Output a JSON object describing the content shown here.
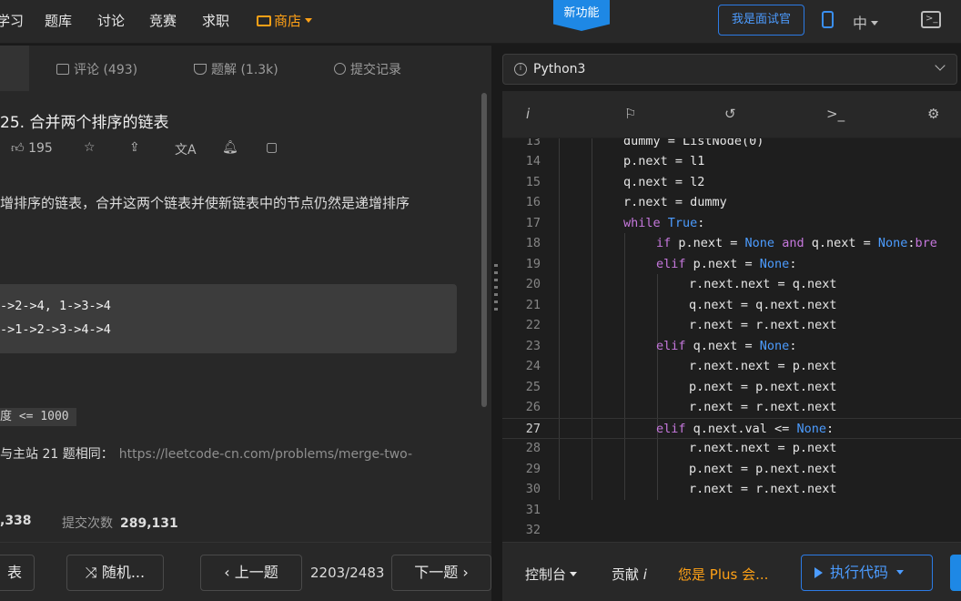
{
  "topnav": {
    "items": [
      "学习",
      "题库",
      "讨论",
      "竞赛",
      "求职"
    ],
    "shop": "商店",
    "new_feature": "新功能",
    "interviewer": "我是面试官",
    "lang": "中"
  },
  "left_tabs": {
    "comments": "评论 (493)",
    "solutions": "题解 (1.3k)",
    "submissions": "提交记录"
  },
  "problem": {
    "title": "25. 合并两个排序的链表",
    "likes": "195",
    "description": "增排序的链表，合并这两个链表并使新链表中的节点仍然是递增排序",
    "example_input": "->2->4, 1->3->4",
    "example_output": "->1->2->3->4->4",
    "constraint": "度 <= 1000",
    "note": "与主站 21 题相同：",
    "note_link": "https://leetcode-cn.com/problems/merge-two-",
    "accepted_count": ",338",
    "submissions_label": "提交次数",
    "submissions_count": "289,131"
  },
  "bottom_left": {
    "list_btn": "表",
    "random_btn": "随机...",
    "prev_btn": "上一题",
    "counter": "2203/2483",
    "next_btn": "下一题"
  },
  "editor": {
    "language": "Python3",
    "line_numbers": [
      "13",
      "14",
      "15",
      "16",
      "17",
      "18",
      "19",
      "20",
      "21",
      "22",
      "23",
      "24",
      "25",
      "26",
      "27",
      "28",
      "29",
      "30",
      "31",
      "32"
    ]
  },
  "bottom_right": {
    "console": "控制台",
    "contribute": "贡献",
    "plus": "您是 Plus 会...",
    "run": "执行代码"
  },
  "colors": {
    "accent": "#1e88e5",
    "shop": "#ffa116",
    "keyword": "#c678dd",
    "constant": "#4c9cff"
  }
}
